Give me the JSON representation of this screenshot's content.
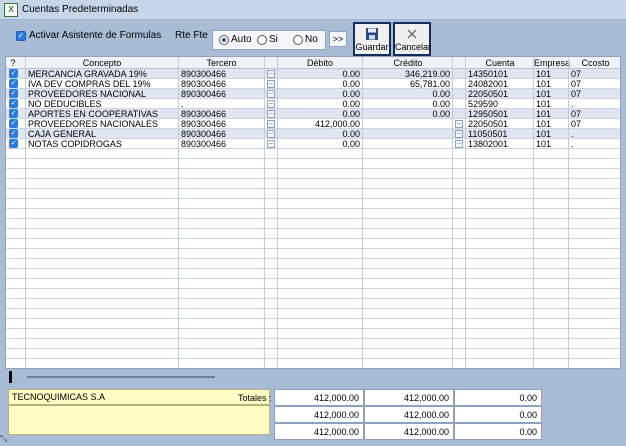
{
  "window": {
    "title": "Cuentas Predeterminadas"
  },
  "toolbar": {
    "assist_label": "Activar Asistente de Formulas",
    "rte_label": "Rte Fte",
    "radio_options": [
      "Auto",
      "Si",
      "No"
    ],
    "radio_selected": "Auto",
    "arrows_label": ">>",
    "save_label": "Guardar",
    "cancel_label": "Cancelar"
  },
  "grid": {
    "columns": [
      "?",
      "Concepto",
      "Tercero",
      "Débito",
      "Crédito",
      "Cuenta",
      "Empresa",
      "Ccosto"
    ],
    "rows": [
      {
        "checked": true,
        "concepto": "MERCANCIA GRAVADA 19%",
        "tercero": "890300466",
        "debito": "0.00",
        "credito": "346,219.00",
        "cuenta": "14350101",
        "empresa": "101",
        "ccosto": "07"
      },
      {
        "checked": true,
        "concepto": "IVA DEV COMPRAS DEL 19%",
        "tercero": "890300466",
        "debito": "0.00",
        "credito": "65,781.00",
        "cuenta": "24082001",
        "empresa": "101",
        "ccosto": "07"
      },
      {
        "checked": true,
        "concepto": "PROVEEDORES NACIONAL",
        "tercero": "890300466",
        "debito": "0.00",
        "credito": "0.00",
        "cuenta": "22050501",
        "empresa": "101",
        "ccosto": "07"
      },
      {
        "checked": true,
        "concepto": "NO DEDUCIBLES",
        "tercero": ".",
        "debito": "0.00",
        "credito": "0.00",
        "cuenta": "529590",
        "empresa": "101",
        "ccosto": "."
      },
      {
        "checked": true,
        "concepto": "APORTES EN COOPERATIVAS",
        "tercero": "890300466",
        "debito": "0.00",
        "credito": "0.00",
        "cuenta": "12950501",
        "empresa": "101",
        "ccosto": "07"
      },
      {
        "checked": true,
        "concepto": "PROVEEDORES NACIONALES",
        "tercero": "890300466",
        "debito": "412,000.00",
        "credito": "",
        "cuenta": "22050501",
        "empresa": "101",
        "ccosto": "07"
      },
      {
        "checked": true,
        "concepto": "CAJA GENERAL",
        "tercero": "890300466",
        "debito": "0.00",
        "credito": "",
        "cuenta": "11050501",
        "empresa": "101",
        "ccosto": "."
      },
      {
        "checked": true,
        "concepto": "NOTAS COPIDROGAS",
        "tercero": "890300466",
        "debito": "0.00",
        "credito": "",
        "cuenta": "13802001",
        "empresa": "101",
        "ccosto": "."
      }
    ],
    "dropdown_glyph": "..",
    "check_glyph": "✓"
  },
  "footer": {
    "name": "TECNOQUIMICAS S.A",
    "totals_label": "Totales :",
    "totals": [
      [
        "412,000.00",
        "412,000.00",
        "0.00"
      ],
      [
        "412,000.00",
        "412,000.00",
        "0.00"
      ],
      [
        "412,000.00",
        "412,000.00",
        "0.00"
      ]
    ]
  },
  "colors": {
    "background": "#a8bcd6",
    "checkbox": "#2a7be0",
    "note_field": "#fffcc4",
    "button_border": "#142e5a"
  }
}
